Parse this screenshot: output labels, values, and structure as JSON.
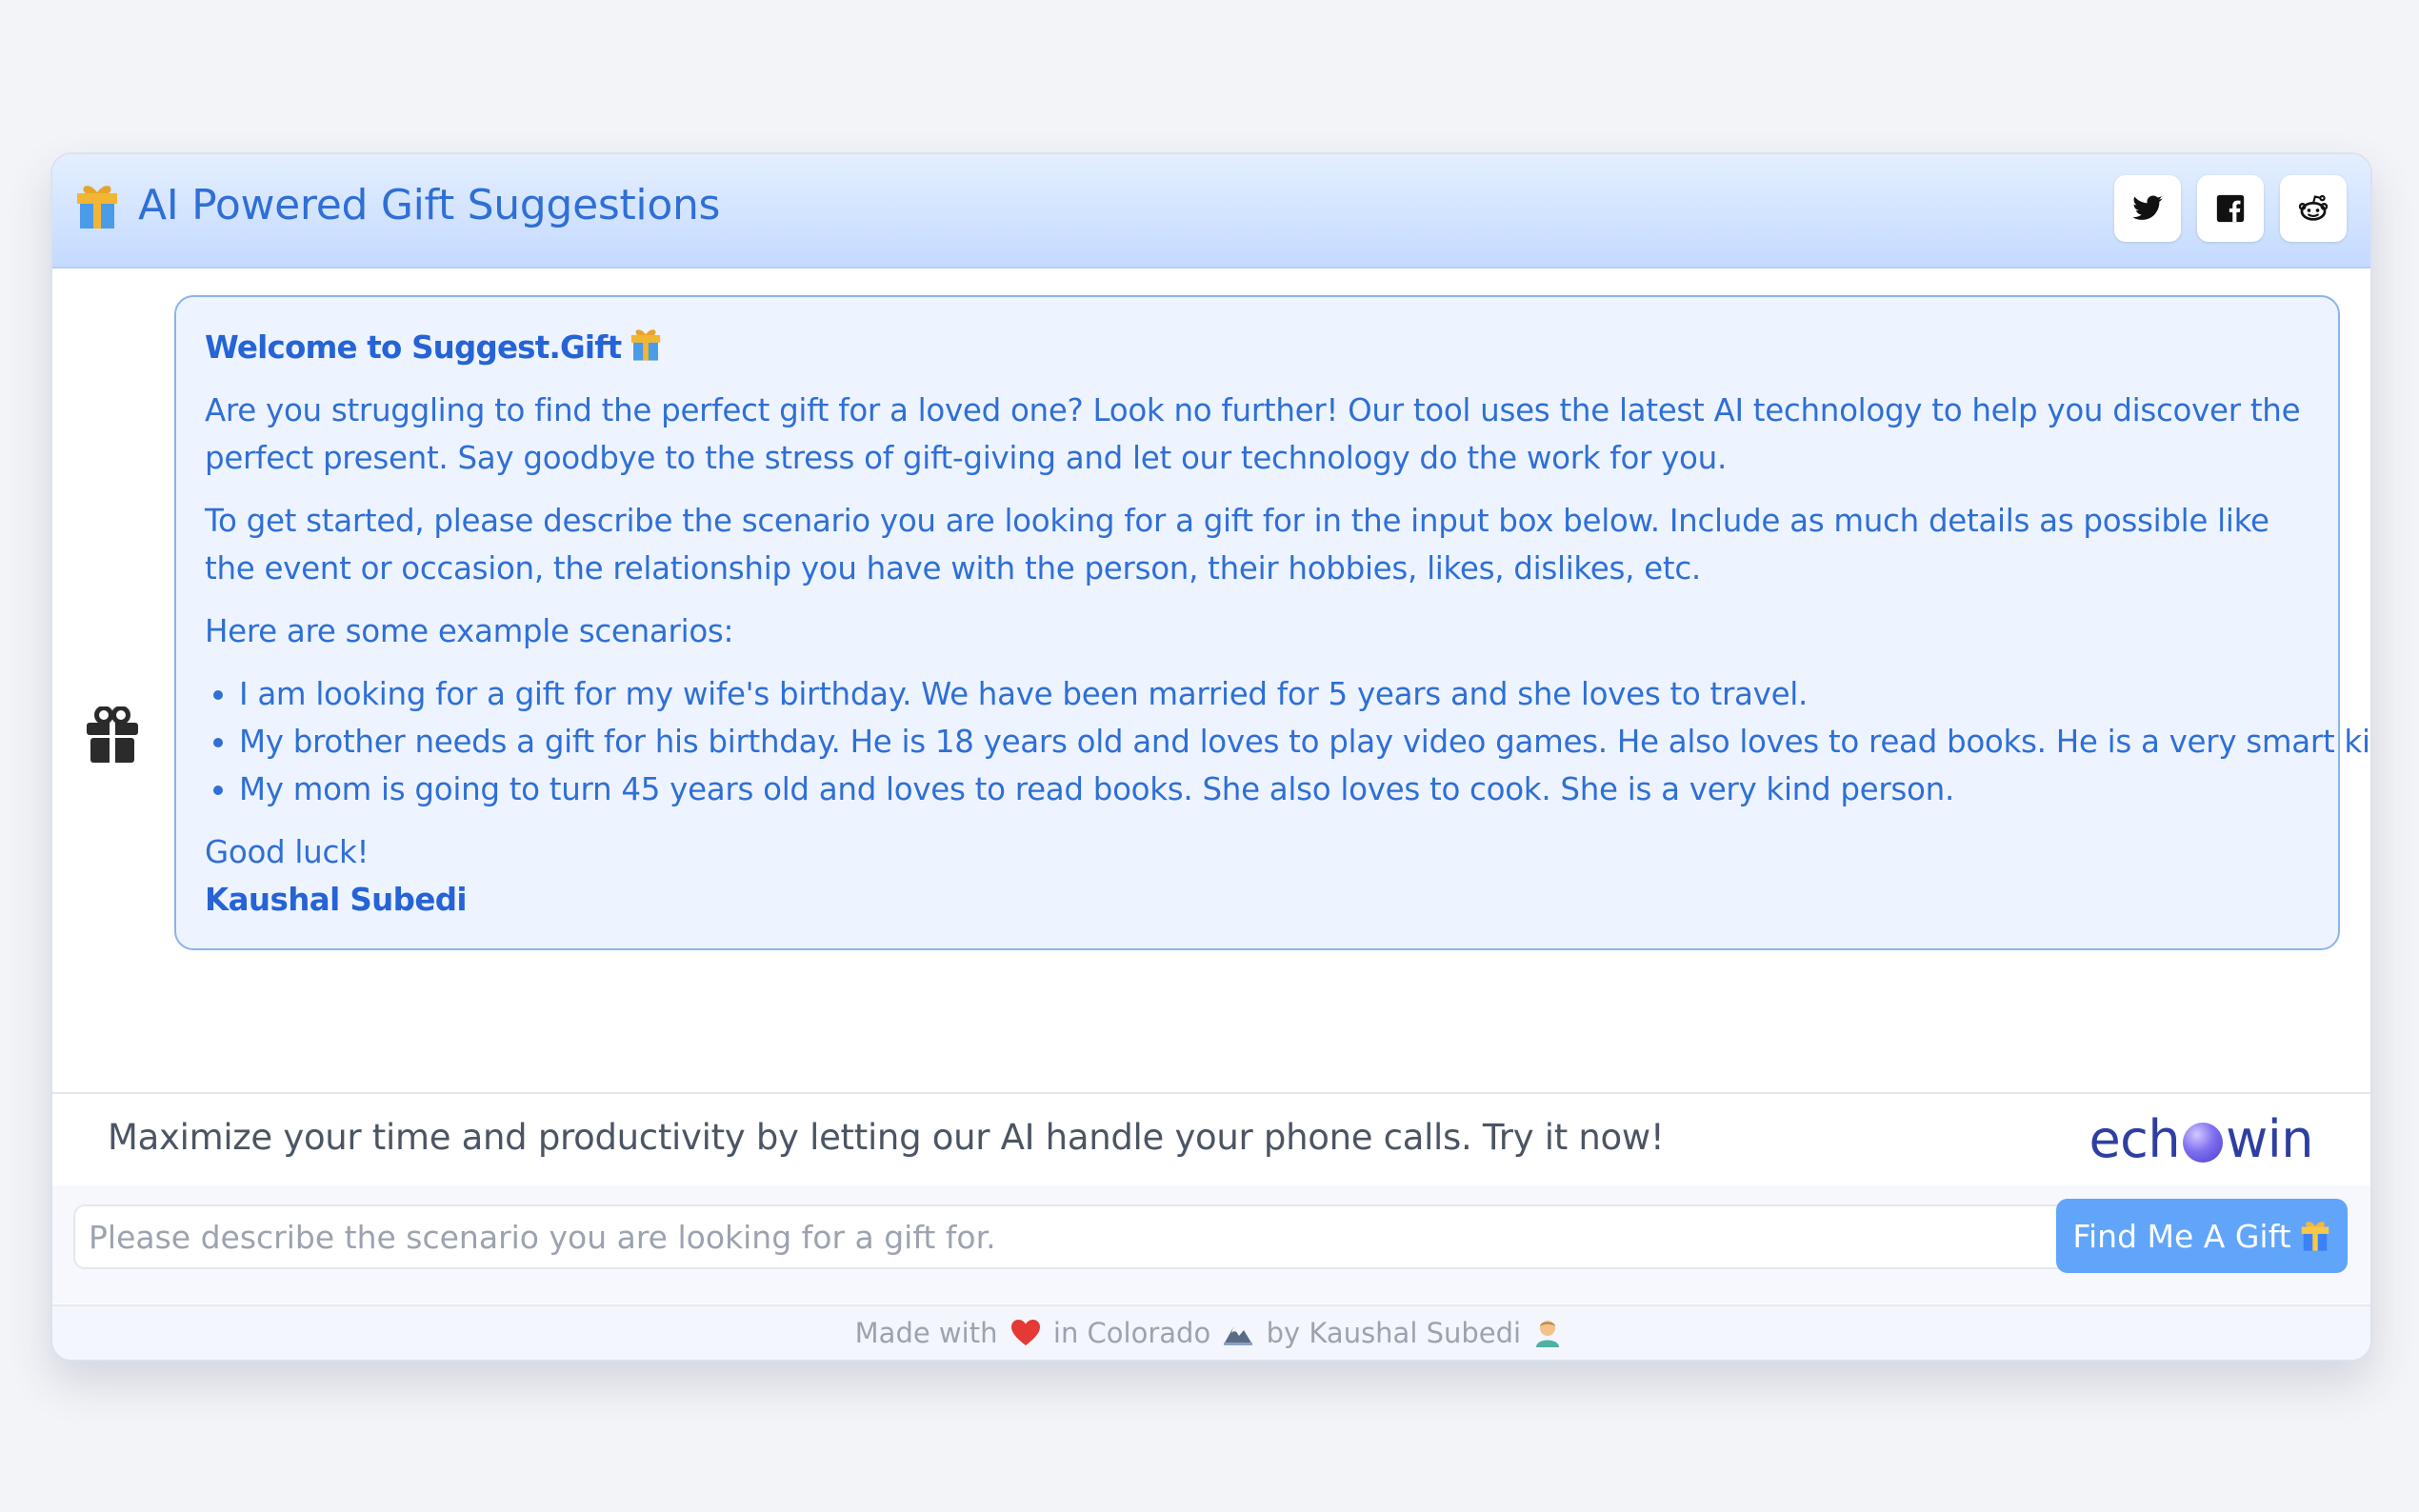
{
  "header": {
    "title": "AI Powered Gift Suggestions",
    "icon": "gift-emoji-icon",
    "share_buttons": [
      "twitter-icon",
      "facebook-icon",
      "reddit-icon"
    ]
  },
  "message": {
    "avatar_icon": "gift-icon",
    "title": "Welcome to Suggest.Gift",
    "intro": "Are you struggling to find the perfect gift for a loved one? Look no further! Our tool uses the latest AI technology to help you discover the perfect present. Say goodbye to the stress of gift-giving and let our technology do the work for you.",
    "instructions": "To get started, please describe the scenario you are looking for a gift for in the input box below. Include as much details as possible like the event or occasion, the relationship you have with the person, their hobbies, likes, dislikes, etc.",
    "examples_heading": "Here are some example scenarios:",
    "examples": [
      "I am looking for a gift for my wife's birthday. We have been married for 5 years and she loves to travel.",
      "My brother needs a gift for his birthday. He is 18 years old and loves to play video games. He also loves to read books. He is a very smart kid.",
      "My mom is going to turn 45 years old and loves to read books. She also loves to cook. She is a very kind person."
    ],
    "closing": "Good luck!",
    "signature": "Kaushal Subedi"
  },
  "promo": {
    "text": "Maximize your time and productivity by letting our AI handle your phone calls. Try it now!",
    "logo_left": "ech",
    "logo_right": "win"
  },
  "input": {
    "value": "",
    "placeholder": "Please describe the scenario you are looking for a gift for."
  },
  "button": {
    "label": "Find Me A Gift"
  },
  "footer": {
    "part1": "Made with",
    "part2": "in Colorado",
    "part3": "by Kaushal Subedi"
  },
  "colors": {
    "accent": "#2f6fd6",
    "header_bg": "#c4daff",
    "bubble_bg": "#eef4ff",
    "button_bg": "#60a5fa",
    "logo": "#2f3fa0"
  }
}
